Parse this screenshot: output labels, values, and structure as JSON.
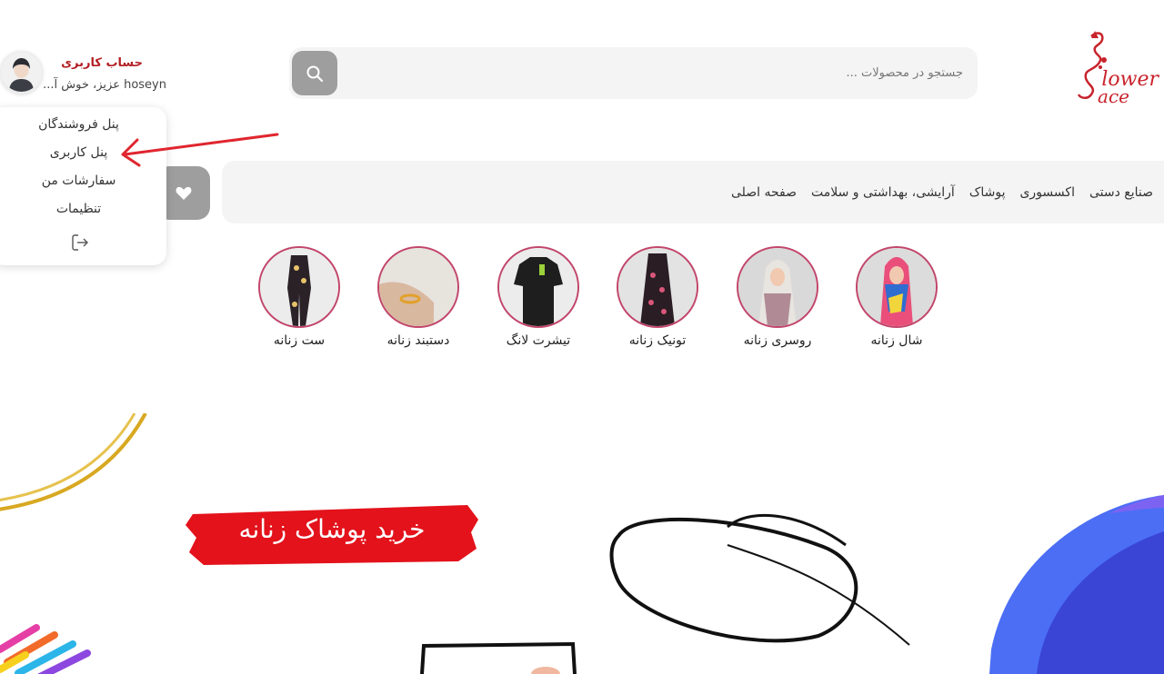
{
  "logo": {
    "alt": "Flower Face",
    "line1": "lower",
    "line2": "ace"
  },
  "search": {
    "placeholder": "جستجو در محصولات ..."
  },
  "account": {
    "title": "حساب کاربری",
    "greeting": "hoseyn عزیز، خوش آ..."
  },
  "account_menu": {
    "items": [
      "پنل فروشندگان",
      "پنل کاربری",
      "سفارشات من",
      "تنظیمات"
    ]
  },
  "nav": {
    "items": [
      "صفحه اصلی",
      "آرایشی، بهداشتی و سلامت",
      "پوشاک",
      "اکسسوری",
      "صنایع دستی"
    ]
  },
  "categories": [
    {
      "label": "شال زنانه",
      "icon": "scarf-photo"
    },
    {
      "label": "روسری زنانه",
      "icon": "headscarf-photo"
    },
    {
      "label": "تونیک زنانه",
      "icon": "tunic-photo"
    },
    {
      "label": "تیشرت لانگ",
      "icon": "tshirt-photo"
    },
    {
      "label": "دستبند زنانه",
      "icon": "bracelet-photo"
    },
    {
      "label": "ست زنانه",
      "icon": "set-photo"
    }
  ],
  "banner": {
    "title": "خرید پوشاک زنانه"
  },
  "colors": {
    "brand": "#c8232c",
    "accent_gray": "#9e9e9e",
    "panel": "#f4f4f4"
  }
}
